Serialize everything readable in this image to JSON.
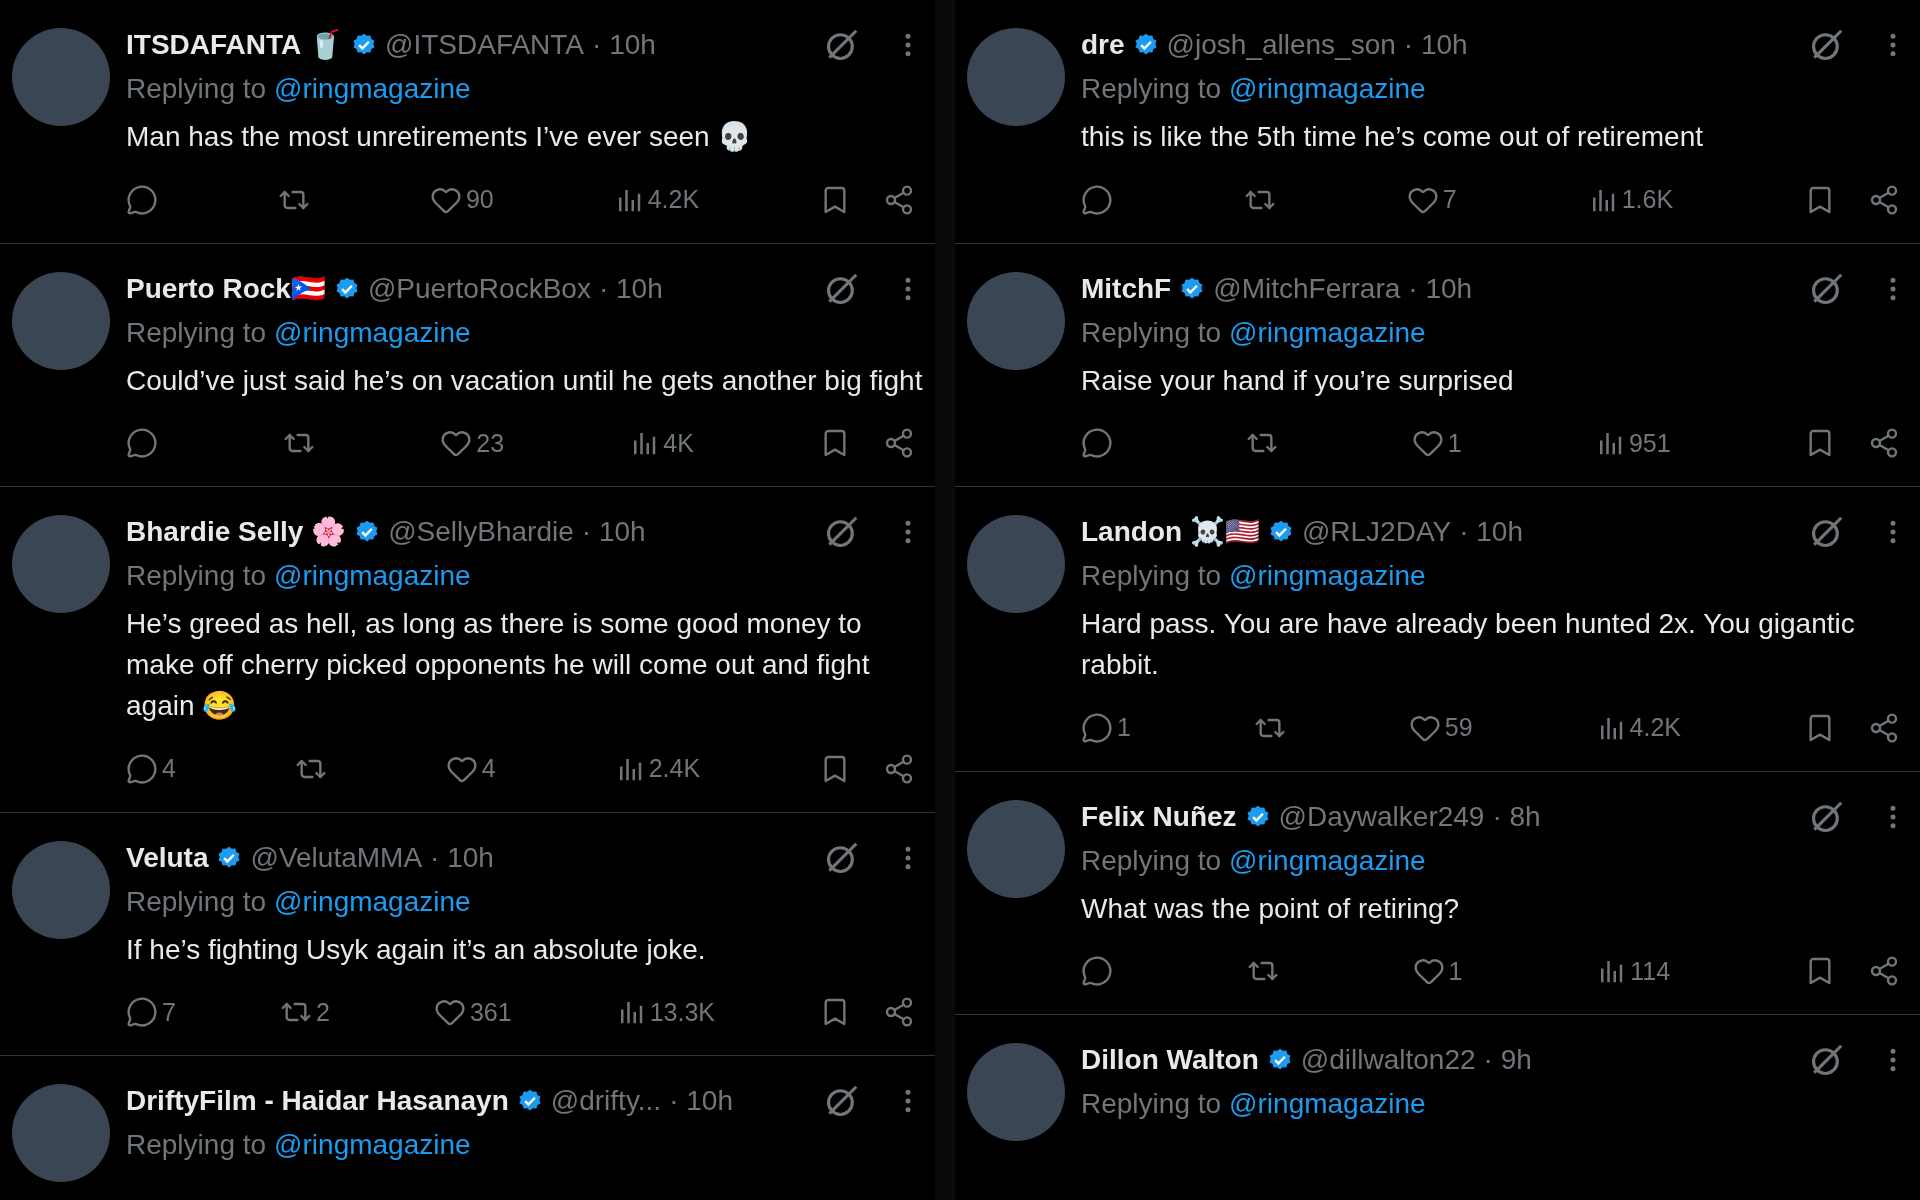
{
  "columns": [
    {
      "tweets": [
        {
          "name": "ITSDAFANTA 🥤",
          "handle": "@ITSDAFANTA",
          "time": "· 10h",
          "replying_prefix": "Replying to",
          "replying_handle": "@ringmagazine",
          "text": "Man has the most unretirements I’ve ever seen 💀",
          "likes": "90",
          "views": "4.2K"
        },
        {
          "name": "Puerto Rock🇵🇷",
          "handle": "@PuertoRockBox",
          "time": "· 10h",
          "replying_prefix": "Replying to",
          "replying_handle": "@ringmagazine",
          "text": "Could’ve just said he’s on vacation until he gets another big fight",
          "likes": "23",
          "views": "4K"
        },
        {
          "name": "Bhardie Selly 🌸",
          "handle": "@SellyBhardie",
          "time": "· 10h",
          "replying_prefix": "Replying to",
          "replying_handle": "@ringmagazine",
          "text": "He’s greed as hell, as long as there is some good money to make off cherry picked opponents he will come out and fight again 😂",
          "replies": "4",
          "likes": "4",
          "views": "2.4K"
        },
        {
          "name": "Veluta",
          "handle": "@VelutaMMA",
          "time": "· 10h",
          "replying_prefix": "Replying to",
          "replying_handle": "@ringmagazine",
          "text": "If he’s fighting Usyk again it’s an absolute joke.",
          "replies": "7",
          "reposts": "2",
          "likes": "361",
          "views": "13.3K"
        },
        {
          "name": "DriftyFilm - Haidar Hasanayn",
          "handle": "@drifty...",
          "time": "· 10h",
          "replying_prefix": "Replying to",
          "replying_handle": "@ringmagazine"
        }
      ]
    },
    {
      "tweets": [
        {
          "name": "dre",
          "handle": "@josh_allens_son",
          "time": "· 10h",
          "replying_prefix": "Replying to",
          "replying_handle": "@ringmagazine",
          "text": "this is like the 5th time he’s come out of retirement",
          "likes": "7",
          "views": "1.6K"
        },
        {
          "name": "MitchF",
          "handle": "@MitchFerrara",
          "time": "· 10h",
          "replying_prefix": "Replying to",
          "replying_handle": "@ringmagazine",
          "text": "Raise your hand if you’re surprised",
          "likes": "1",
          "views": "951"
        },
        {
          "name": "Landon ☠️🇺🇸",
          "handle": "@RLJ2DAY",
          "time": "· 10h",
          "replying_prefix": "Replying to",
          "replying_handle": "@ringmagazine",
          "text": "Hard pass. You are have already been hunted 2x. You gigantic rabbit.",
          "replies": "1",
          "likes": "59",
          "views": "4.2K"
        },
        {
          "name": "Felix Nuñez",
          "handle": "@Daywalker249",
          "time": "· 8h",
          "replying_prefix": "Replying to",
          "replying_handle": "@ringmagazine",
          "text": "What was the point of retiring?",
          "likes": "1",
          "views": "114"
        },
        {
          "name": "Dillon Walton",
          "handle": "@dillwalton22",
          "time": "· 9h",
          "replying_prefix": "Replying to",
          "replying_handle": "@ringmagazine"
        }
      ]
    }
  ]
}
